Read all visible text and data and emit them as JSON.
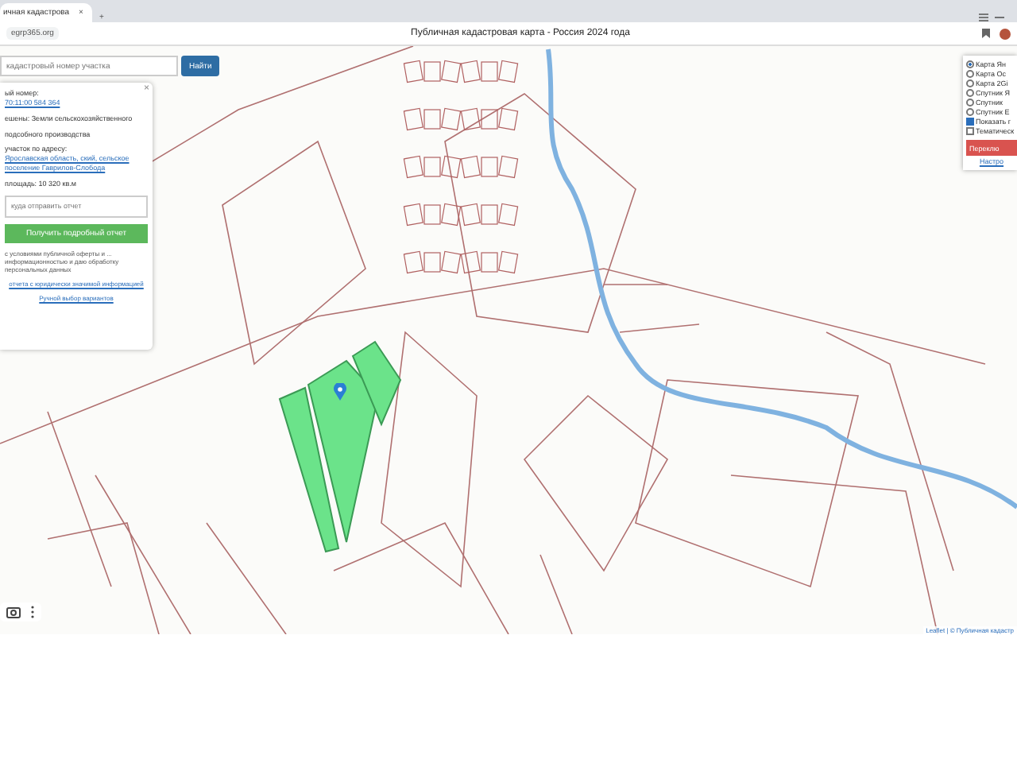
{
  "browser": {
    "tab": {
      "title": "ичная кадастрова",
      "close": "×"
    },
    "new_tab": "+",
    "url": "egrp365.org",
    "page_title": "Публичная кадастровая карта - Россия 2024 года"
  },
  "search": {
    "placeholder": "кадастровый номер участка",
    "button": "Найти"
  },
  "info_card": {
    "close": "×",
    "lines": [
      {
        "label": "ый номер:",
        "value": "70:11:00 584 364",
        "kind": "link"
      },
      {
        "label": "ешены:",
        "value": "Земли сельскохозяйственного",
        "kind": "plain"
      },
      {
        "value": "подсобного производства",
        "kind": "plain"
      },
      {
        "label": "участок по адресу:",
        "value": "Ярославская область, ский, сельское поселение Гаврилов-Слобода",
        "kind": "link"
      },
      {
        "label": "площадь:",
        "value": "10 320 кв.м",
        "kind": "plain"
      }
    ],
    "email_placeholder": "куда отправить отчет",
    "report_button": "Получить подробный отчет",
    "terms": "с условиями публичной оферты и ... информационностью и даю обработку персональных данных",
    "links": [
      "отчета с юридически значимой информацией",
      "Ручной выбор вариантов"
    ]
  },
  "layers": {
    "options": [
      {
        "label": "Карта Ян",
        "selected": true
      },
      {
        "label": "Карта Ос",
        "selected": false
      },
      {
        "label": "Карта 2Gi",
        "selected": false
      },
      {
        "label": "Спутник Я",
        "selected": false
      },
      {
        "label": "Спутник",
        "selected": false
      },
      {
        "label": "Спутник E",
        "selected": false
      }
    ],
    "checks": [
      {
        "label": "Показать г",
        "checked": true
      },
      {
        "label": "Тематическ",
        "checked": false
      }
    ],
    "button": "Переклю",
    "settings_link": "Настро"
  },
  "attribution": "Leaflet | © Публичная кадастр"
}
